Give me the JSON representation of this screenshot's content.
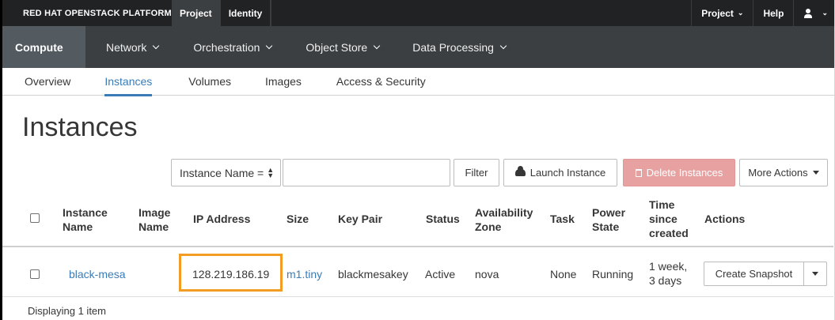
{
  "topbar": {
    "brand": "RED HAT OPENSTACK PLATFORM",
    "tabs": [
      {
        "label": "Project",
        "active": true
      },
      {
        "label": "Identity",
        "active": false
      }
    ],
    "right": {
      "project_menu": "Project",
      "help": "Help",
      "user_icon": "user-icon"
    }
  },
  "secnav": {
    "items": [
      {
        "label": "Compute",
        "active": true
      },
      {
        "label": "Network"
      },
      {
        "label": "Orchestration"
      },
      {
        "label": "Object Store"
      },
      {
        "label": "Data Processing"
      }
    ]
  },
  "tabs": [
    {
      "label": "Overview"
    },
    {
      "label": "Instances",
      "active": true
    },
    {
      "label": "Volumes"
    },
    {
      "label": "Images"
    },
    {
      "label": "Access & Security"
    }
  ],
  "page": {
    "title": "Instances"
  },
  "toolbar": {
    "filter_field": "Instance Name =",
    "filter_value": "",
    "filter_button": "Filter",
    "launch_button": "Launch Instance",
    "delete_button": "Delete Instances",
    "more_button": "More Actions"
  },
  "table": {
    "headers": {
      "instance_name": [
        "Instance",
        "Name"
      ],
      "image_name": [
        "Image",
        "Name"
      ],
      "ip_address": "IP Address",
      "size": "Size",
      "key_pair": "Key Pair",
      "status": "Status",
      "availability_zone": [
        "Availability",
        "Zone"
      ],
      "task": "Task",
      "power_state": [
        "Power",
        "State"
      ],
      "time_since_created": [
        "Time",
        "since",
        "created"
      ],
      "actions": "Actions"
    },
    "rows": [
      {
        "instance_name": "black-mesa",
        "image_name": "",
        "ip_address": "128.219.186.19",
        "size": "m1.tiny",
        "key_pair": "blackmesakey",
        "status": "Active",
        "availability_zone": "nova",
        "task": "None",
        "power_state": "Running",
        "time_since_created": [
          "1 week,",
          "3 days"
        ],
        "action_button": "Create Snapshot"
      }
    ]
  },
  "footer": {
    "summary": "Displaying 1 item"
  },
  "colors": {
    "accent": "#3a7cb8",
    "highlight": "#f39c24",
    "danger_disabled": "#e8a1a1",
    "topbar_bg": "#202224",
    "secnav_bg": "#3b3f42"
  }
}
